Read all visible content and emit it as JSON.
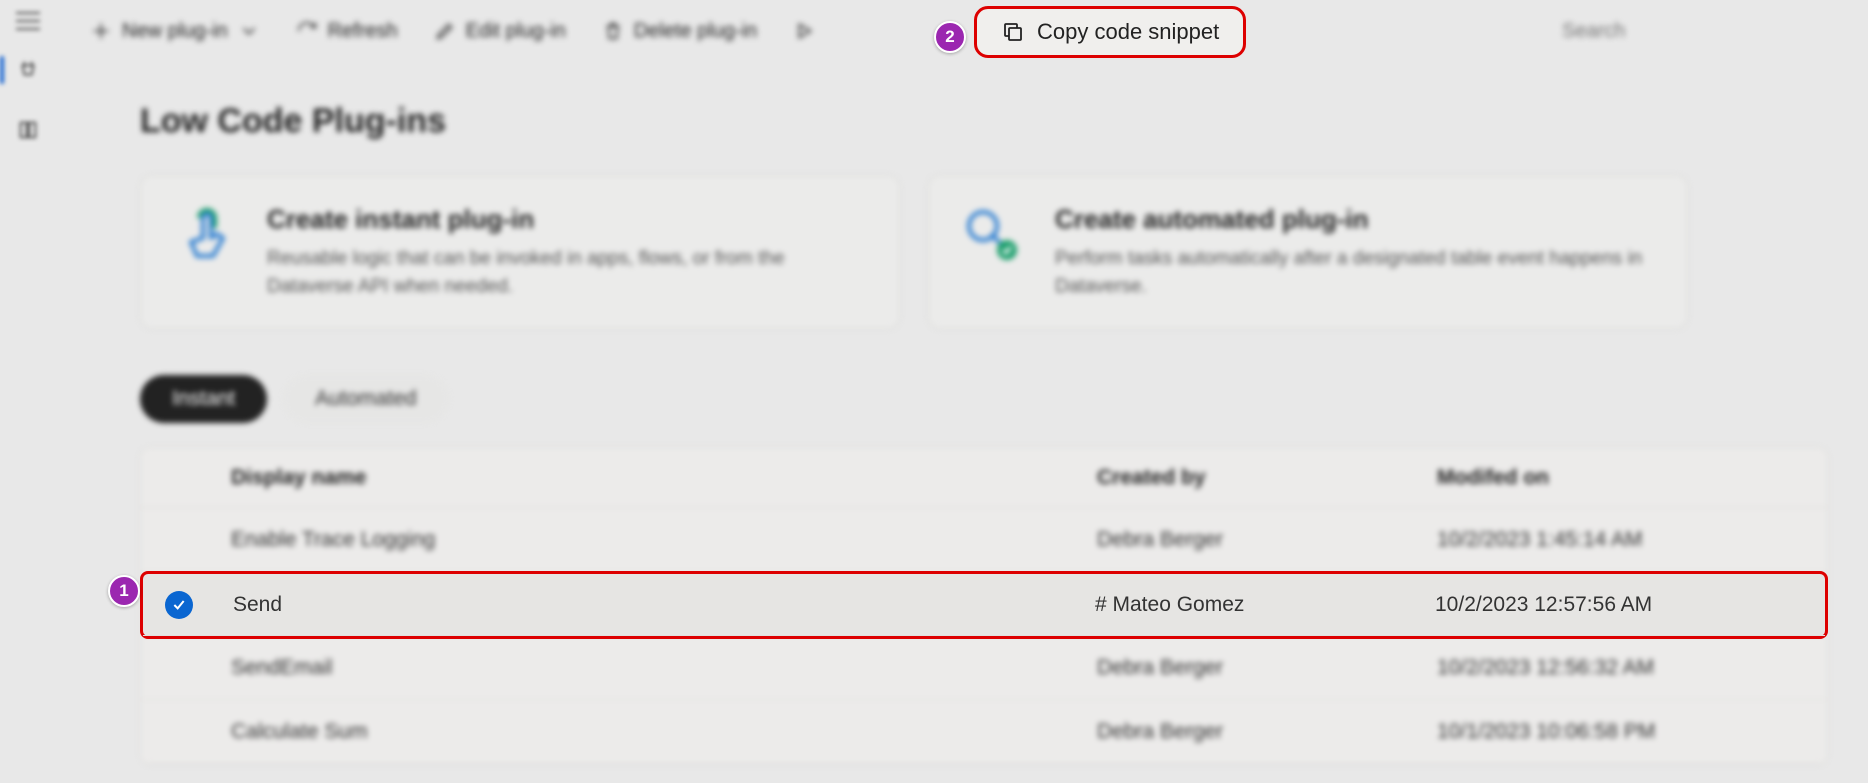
{
  "toolbar": {
    "new_plugin": "New plug-in",
    "refresh": "Refresh",
    "edit_plugin": "Edit plug-in",
    "delete_plugin": "Delete plug-in",
    "copy_snippet": "Copy code snippet",
    "search_placeholder": "Search"
  },
  "callouts": {
    "one": "1",
    "two": "2"
  },
  "page": {
    "title": "Low Code Plug-ins"
  },
  "cards": {
    "instant": {
      "title": "Create instant plug-in",
      "desc": "Reusable logic that can be invoked in apps, flows, or from the Dataverse API when needed."
    },
    "automated": {
      "title": "Create automated plug-in",
      "desc": "Perform tasks automatically after a designated table event happens in Dataverse."
    }
  },
  "tabs": {
    "instant": "Instant",
    "automated": "Automated"
  },
  "table": {
    "headers": {
      "display_name": "Display name",
      "created_by": "Created by",
      "modified_on": "Modifed on"
    },
    "rows": [
      {
        "display_name": "Enable Trace Logging",
        "created_by": "Debra Berger",
        "modified_on": "10/2/2023 1:45:14 AM"
      },
      {
        "display_name": "Send",
        "created_by": "# Mateo Gomez",
        "modified_on": "10/2/2023 12:57:56 AM"
      },
      {
        "display_name": "SendEmail",
        "created_by": "Debra Berger",
        "modified_on": "10/2/2023 12:56:32 AM"
      },
      {
        "display_name": "Calculate Sum",
        "created_by": "Debra Berger",
        "modified_on": "10/1/2023 10:06:58 PM"
      }
    ]
  }
}
